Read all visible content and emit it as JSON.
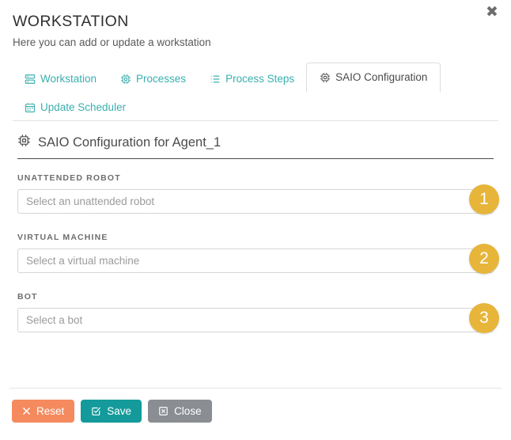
{
  "window": {
    "close_label": "✖"
  },
  "header": {
    "title": "WORKSTATION",
    "subtitle": "Here you can add or update a workstation"
  },
  "tabs": {
    "row1": [
      {
        "label": "Workstation",
        "icon": "server-icon",
        "active": false
      },
      {
        "label": "Processes",
        "icon": "cpu-icon",
        "active": false
      },
      {
        "label": "Process Steps",
        "icon": "list-icon",
        "active": false
      },
      {
        "label": "SAIO Configuration",
        "icon": "cpu-icon",
        "active": true
      }
    ],
    "row2": [
      {
        "label": "Update Scheduler",
        "icon": "calendar-icon",
        "active": false
      }
    ]
  },
  "section": {
    "icon": "cpu-icon",
    "title": "SAIO Configuration for Agent_1"
  },
  "form": {
    "fields": [
      {
        "label": "UNATTENDED ROBOT",
        "placeholder": "Select an unattended robot",
        "value": "",
        "badge": "1"
      },
      {
        "label": "VIRTUAL MACHINE",
        "placeholder": "Select a virtual machine",
        "value": "",
        "badge": "2"
      },
      {
        "label": "BOT",
        "placeholder": "Select a bot",
        "value": "",
        "badge": "3"
      }
    ]
  },
  "footer": {
    "buttons": [
      {
        "label": "Reset",
        "icon": "times-icon",
        "color": "#f58a5e"
      },
      {
        "label": "Save",
        "icon": "check-square-icon",
        "color": "#149a9a"
      },
      {
        "label": "Close",
        "icon": "times-square-icon",
        "color": "#8a8e93"
      }
    ]
  },
  "colors": {
    "tab_link": "#3aafaf",
    "badge": "#e8b53b",
    "reset": "#f58a5e",
    "save": "#149a9a",
    "close": "#8a8e93",
    "text": "#3c3c3c"
  }
}
